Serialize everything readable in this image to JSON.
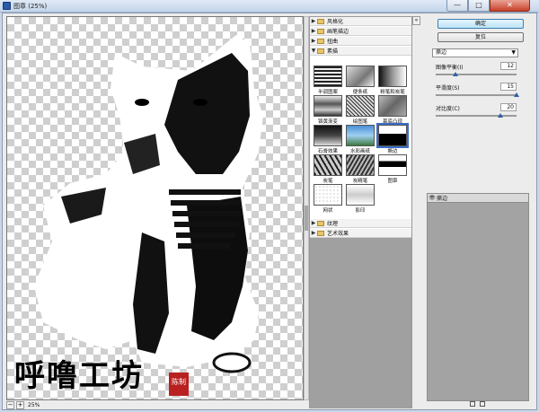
{
  "window": {
    "title": "图章 (25%)",
    "min_symbol": "—",
    "max_symbol": "□",
    "close_symbol": "✕"
  },
  "preview": {
    "zoom_value": "25%",
    "zoom_out": "−",
    "zoom_in": "+",
    "watermark_text": "呼噜工坊",
    "seal_text": "陈制"
  },
  "gallery": {
    "collapse_symbol": "«",
    "folders_top": [
      {
        "label": "风格化",
        "expanded": false
      },
      {
        "label": "画笔描边",
        "expanded": false
      },
      {
        "label": "扭曲",
        "expanded": false
      },
      {
        "label": "素描",
        "expanded": true
      }
    ],
    "thumbnails": [
      {
        "label": "半调图案"
      },
      {
        "label": "便条纸"
      },
      {
        "label": "粉笔和炭笔"
      },
      {
        "label": "铬黄渐变"
      },
      {
        "label": "绘图笔"
      },
      {
        "label": "基底凸现"
      },
      {
        "label": "石膏效果"
      },
      {
        "label": "水彩画纸"
      },
      {
        "label": "撕边"
      },
      {
        "label": "炭笔"
      },
      {
        "label": "炭精笔"
      },
      {
        "label": "图章"
      },
      {
        "label": "网状"
      },
      {
        "label": "影印"
      }
    ],
    "folders_bottom": [
      {
        "label": "纹理",
        "expanded": false
      },
      {
        "label": "艺术效果",
        "expanded": false
      }
    ]
  },
  "controls": {
    "ok_label": "确定",
    "reset_label": "复位",
    "filter_select": "撕边",
    "params": [
      {
        "label": "图像平衡(I)",
        "value": "12",
        "fraction": 0.24
      },
      {
        "label": "平滑度(S)",
        "value": "15",
        "fraction": 1.0
      },
      {
        "label": "对比度(C)",
        "value": "20",
        "fraction": 0.8
      }
    ]
  },
  "layers": {
    "items": [
      {
        "name": "撕边",
        "visible_symbol": "👁"
      }
    ]
  },
  "colors": {
    "accent": "#3a6bc9",
    "close_red": "#c8402a"
  }
}
